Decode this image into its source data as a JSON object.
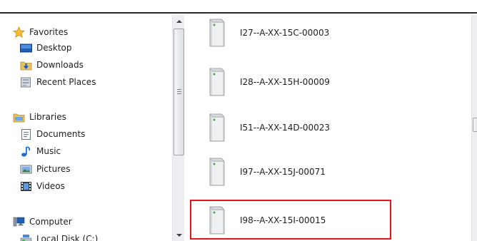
{
  "nav": {
    "favorites": {
      "label": "Favorites",
      "items": [
        {
          "label": "Desktop",
          "icon": "desktop-icon"
        },
        {
          "label": "Downloads",
          "icon": "downloads-icon"
        },
        {
          "label": "Recent Places",
          "icon": "recent-places-icon"
        }
      ]
    },
    "libraries": {
      "label": "Libraries",
      "items": [
        {
          "label": "Documents",
          "icon": "documents-icon"
        },
        {
          "label": "Music",
          "icon": "music-icon"
        },
        {
          "label": "Pictures",
          "icon": "pictures-icon"
        },
        {
          "label": "Videos",
          "icon": "videos-icon"
        }
      ]
    },
    "computer": {
      "label": "Computer",
      "items": [
        {
          "label": "Local Disk (C:)",
          "icon": "local-disk-icon"
        }
      ]
    }
  },
  "files": [
    {
      "name": "I27--A-XX-15C-00003",
      "icon": "network-drive-icon"
    },
    {
      "name": "I28--A-XX-15H-00009",
      "icon": "network-drive-icon"
    },
    {
      "name": "I51--A-XX-14D-00023",
      "icon": "network-drive-icon"
    },
    {
      "name": "I97--A-XX-15J-00071",
      "icon": "network-drive-icon"
    },
    {
      "name": "I98--A-XX-15I-00015",
      "icon": "network-drive-icon",
      "highlighted": true
    }
  ],
  "colors": {
    "highlight_border": "#e8121b",
    "scrollbar_track": "#eceef2",
    "folder_yellow": "#e9c25a"
  }
}
